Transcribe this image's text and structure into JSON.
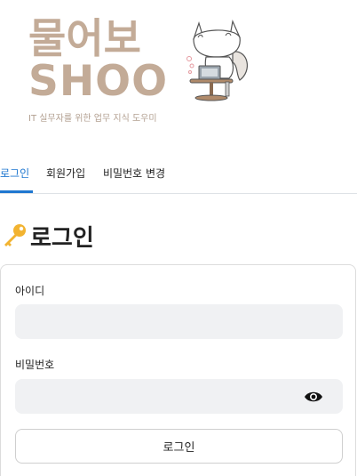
{
  "logo": {
    "title_kr": "물어보",
    "title_en": "SHOO",
    "subtitle": "IT 실무자를 위한 업무 지식 도우미",
    "mascot": "fox-with-laptop-mascot",
    "brand_color": "#c3ab97"
  },
  "tabs": [
    {
      "label": "로그인",
      "active": true
    },
    {
      "label": "회원가입",
      "active": false
    },
    {
      "label": "비밀번호 변경",
      "active": false
    }
  ],
  "heading": {
    "icon": "key-icon",
    "title": "로그인"
  },
  "form": {
    "id_label": "아이디",
    "id_value": "",
    "password_label": "비밀번호",
    "password_value": "",
    "password_toggle_icon": "eye-icon",
    "submit_label": "로그인"
  },
  "colors": {
    "accent": "#1f77d0",
    "input_bg": "#f0f1f3",
    "border": "#dcdcdc"
  }
}
